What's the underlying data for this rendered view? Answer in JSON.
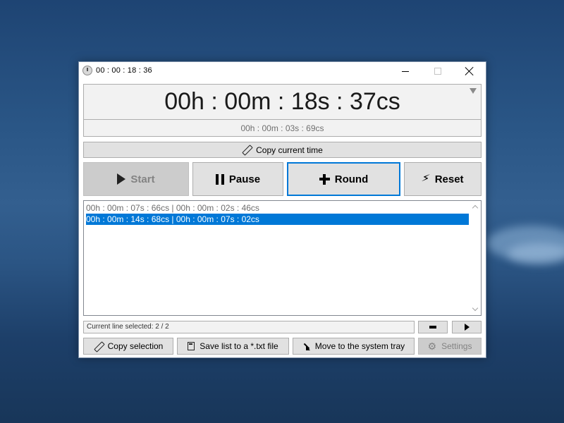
{
  "window": {
    "title": "00 : 00 : 18 : 36"
  },
  "display": {
    "main_time": "00h : 00m : 18s : 37cs",
    "sub_time": "00h : 00m : 03s : 69cs"
  },
  "buttons": {
    "copy_time": "Copy current time",
    "start": "Start",
    "pause": "Pause",
    "round": "Round",
    "reset": "Reset",
    "copy_selection": "Copy selection",
    "save_list": "Save list to a *.txt file",
    "move_tray": "Move to the system tray",
    "settings": "Settings"
  },
  "rounds": [
    {
      "text": "00h : 00m : 07s : 66cs | 00h : 00m : 02s : 46cs",
      "selected": false
    },
    {
      "text": "00h : 00m : 14s : 68cs | 00h : 00m : 07s : 02cs",
      "selected": true
    }
  ],
  "status": {
    "text": "Current line selected: 2 / 2"
  },
  "colors": {
    "accent": "#0078d7",
    "button_bg": "#e1e1e1",
    "disabled_bg": "#cccccc"
  },
  "icons": {
    "title": "stopwatch-icon",
    "copy_time": "pencil-icon",
    "start": "play-icon",
    "pause": "pause-icon",
    "round": "plus-icon",
    "reset": "lightning-icon",
    "remove": "minus-icon",
    "next": "triangle-right-icon",
    "copy_selection": "pencil-icon",
    "save_list": "save-icon",
    "move_tray": "arrow-down-right-icon",
    "settings": "gear-icon"
  }
}
